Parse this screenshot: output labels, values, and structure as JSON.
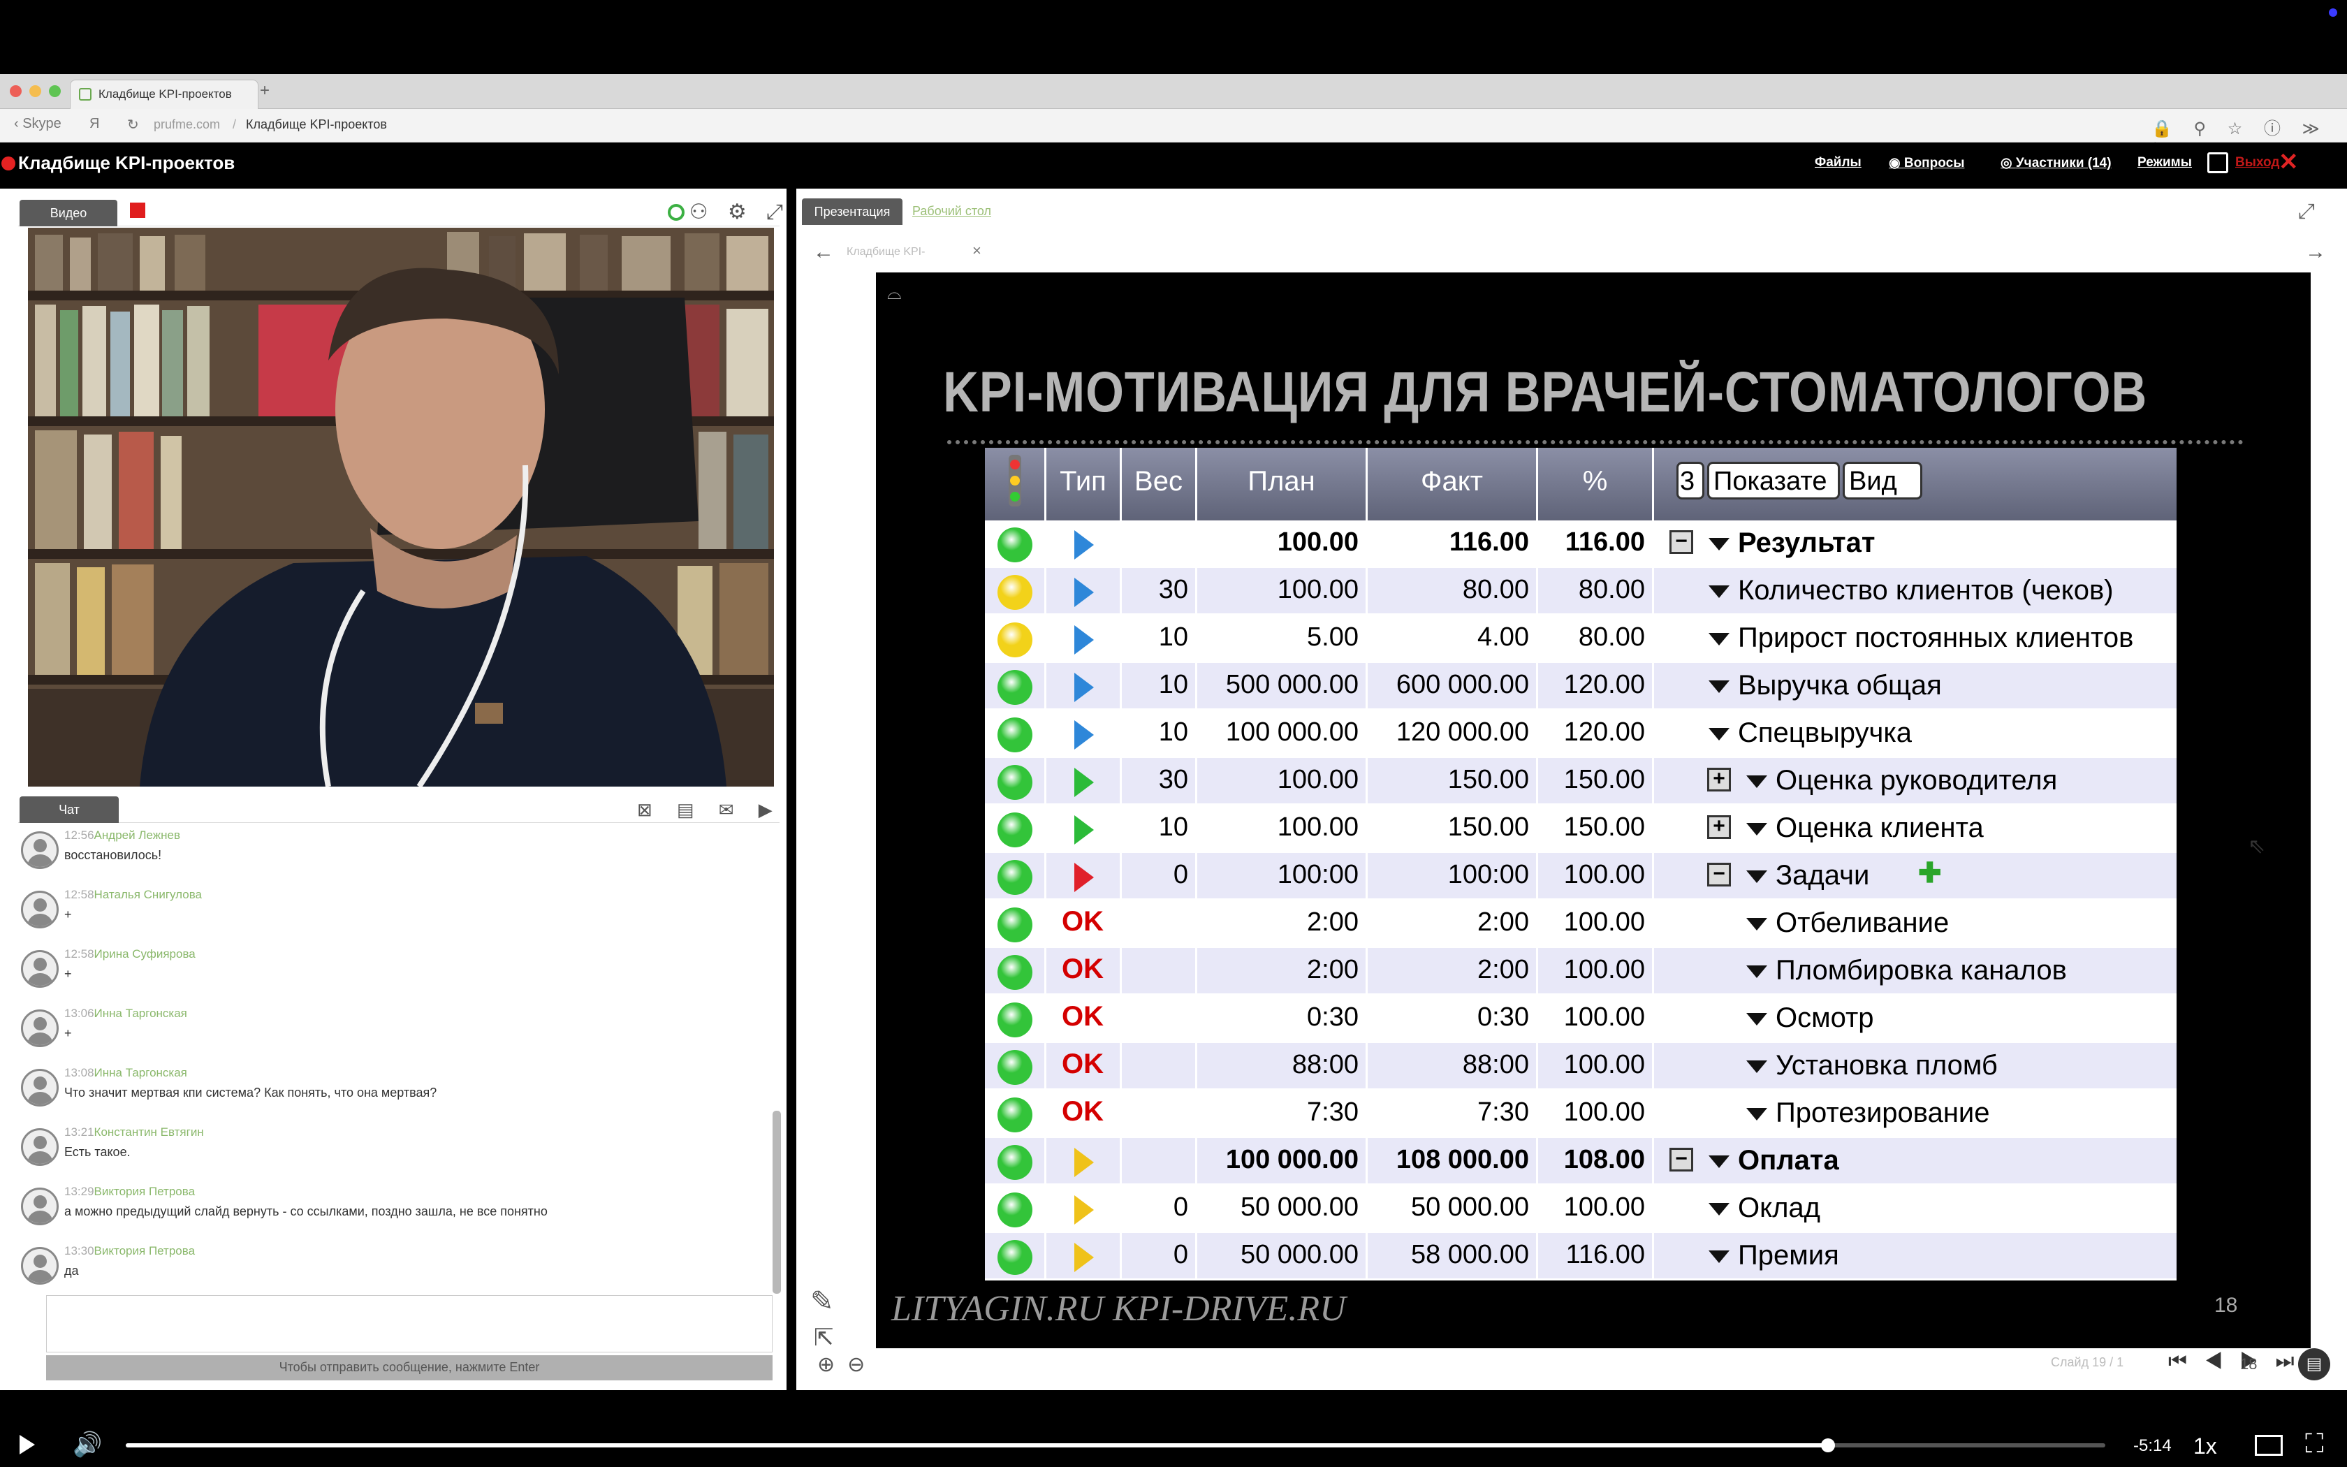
{
  "browser": {
    "tab_title": "Кладбище KPI-проектов",
    "back_label": "Skype",
    "yandex_glyph": "Я",
    "domain": "prufme.com",
    "separator": "/",
    "page_title": "Кладбище KPI-проектов",
    "new_tab_icon": "+",
    "toolbar_icons": "🔒 ⚲ ☆ ⓘ ≫ ⤓"
  },
  "app_header": {
    "title": "Кладбище KPI-проектов",
    "links": [
      "Файлы",
      "Вопросы",
      "Участники (14)",
      "Режимы"
    ],
    "exit_label": "Выход",
    "close_glyph": "✕"
  },
  "video_panel": {
    "tab_label": "Видео",
    "icons": "⚇ ⚙ ⤢"
  },
  "chat_panel": {
    "tab_label": "Чат",
    "icons": "⊠ ▤ ✉ ▶ ⤢",
    "send_hint": "Чтобы отправить сообщение, нажмите Enter",
    "messages": [
      {
        "time": "12:56",
        "author": "Андрей Лежнев",
        "text": "восстановилось!"
      },
      {
        "time": "12:58",
        "author": "Наталья Снигулова",
        "text": "+"
      },
      {
        "time": "12:58",
        "author": "Ирина Суфиярова",
        "text": "+"
      },
      {
        "time": "13:06",
        "author": "Инна Таргонская",
        "text": "+"
      },
      {
        "time": "13:08",
        "author": "Инна Таргонская",
        "text": "Что значит мертвая кпи система? Как понять, что она мертвая?"
      },
      {
        "time": "13:21",
        "author": "Константин Евтягин",
        "text": "Есть такое."
      },
      {
        "time": "13:29",
        "author": "Виктория Петрова",
        "text": "а можно предыдущий слайд вернуть - со ссылками, поздно зашла, не все понятно"
      },
      {
        "time": "13:30",
        "author": "Виктория Петрова",
        "text": "да"
      }
    ]
  },
  "presentation": {
    "tab_label": "Презентация",
    "desktop_link": "Рабочий стол",
    "doc_tab": "Кладбище KPI-",
    "doc_close": "×",
    "slide_title": "KPI-МОТИВАЦИЯ ДЛЯ ВРАЧЕЙ-СТОМАТОЛОГОВ",
    "slide_footer": "LITYAGIN.RU  KPI-DRIVE.RU",
    "slide_number": "18",
    "pager_text": "Слайд  19 / 1",
    "page_field": "18",
    "page_controls": "⏮ ◀    ▶ ⏭"
  },
  "kpi_table": {
    "headers": [
      "Тип",
      "Вес",
      "План",
      "Факт",
      "%"
    ],
    "header_select_count": "3",
    "header_select_show": "Показате",
    "header_select_view": "Вид",
    "status_colors": {
      "green": "#33c43a",
      "yellow": "#f2d21a",
      "red": "#e23a2a"
    },
    "type_colors": {
      "blue": "#2e87d9",
      "green": "#2bbb39",
      "red": "#e0202a",
      "yellow": "#efc21a"
    },
    "rows": [
      {
        "status": "green",
        "type": "blue",
        "weight": "",
        "plan": "100.00",
        "fact": "116.00",
        "pct": "116.00",
        "name": "Результат",
        "level": 0,
        "box": "−",
        "bold": true
      },
      {
        "status": "yellow",
        "type": "blue",
        "weight": "30",
        "plan": "100.00",
        "fact": "80.00",
        "pct": "80.00",
        "name": "Количество клиентов (чеков)",
        "level": 1,
        "box": ""
      },
      {
        "status": "yellow",
        "type": "blue",
        "weight": "10",
        "plan": "5.00",
        "fact": "4.00",
        "pct": "80.00",
        "name": "Прирост постоянных клиентов",
        "level": 1,
        "box": ""
      },
      {
        "status": "green",
        "type": "blue",
        "weight": "10",
        "plan": "500 000.00",
        "fact": "600 000.00",
        "pct": "120.00",
        "name": "Выручка общая",
        "level": 1,
        "box": ""
      },
      {
        "status": "green",
        "type": "blue",
        "weight": "10",
        "plan": "100 000.00",
        "fact": "120 000.00",
        "pct": "120.00",
        "name": "Спецвыручка",
        "level": 1,
        "box": ""
      },
      {
        "status": "green",
        "type": "green",
        "weight": "30",
        "plan": "100.00",
        "fact": "150.00",
        "pct": "150.00",
        "name": "Оценка руководителя",
        "level": 2,
        "box": "+"
      },
      {
        "status": "green",
        "type": "green",
        "weight": "10",
        "plan": "100.00",
        "fact": "150.00",
        "pct": "150.00",
        "name": "Оценка клиента",
        "level": 2,
        "box": "+"
      },
      {
        "status": "green",
        "type": "red",
        "weight": "0",
        "plan": "100:00",
        "fact": "100:00",
        "pct": "100.00",
        "name": "Задачи",
        "level": 2,
        "box": "−",
        "add": "✚"
      },
      {
        "status": "green",
        "type": "ok",
        "type_label": "OK",
        "weight": "",
        "plan": "2:00",
        "fact": "2:00",
        "pct": "100.00",
        "name": "Отбеливание",
        "level": 2,
        "box": ""
      },
      {
        "status": "green",
        "type": "ok",
        "type_label": "OK",
        "weight": "",
        "plan": "2:00",
        "fact": "2:00",
        "pct": "100.00",
        "name": "Пломбировка каналов",
        "level": 2,
        "box": ""
      },
      {
        "status": "green",
        "type": "ok",
        "type_label": "OK",
        "weight": "",
        "plan": "0:30",
        "fact": "0:30",
        "pct": "100.00",
        "name": "Осмотр",
        "level": 2,
        "box": ""
      },
      {
        "status": "green",
        "type": "ok",
        "type_label": "OK",
        "weight": "",
        "plan": "88:00",
        "fact": "88:00",
        "pct": "100.00",
        "name": "Установка пломб",
        "level": 2,
        "box": ""
      },
      {
        "status": "green",
        "type": "ok",
        "type_label": "OK",
        "weight": "",
        "plan": "7:30",
        "fact": "7:30",
        "pct": "100.00",
        "name": "Протезирование",
        "level": 2,
        "box": ""
      },
      {
        "status": "green",
        "type": "yellow",
        "weight": "",
        "plan": "100 000.00",
        "fact": "108 000.00",
        "pct": "108.00",
        "name": "Оплата",
        "level": 0,
        "box": "−",
        "bold": true
      },
      {
        "status": "green",
        "type": "yellow",
        "weight": "0",
        "plan": "50 000.00",
        "fact": "50 000.00",
        "pct": "100.00",
        "name": "Оклад",
        "level": 1,
        "box": ""
      },
      {
        "status": "green",
        "type": "yellow",
        "weight": "0",
        "plan": "50 000.00",
        "fact": "58 000.00",
        "pct": "116.00",
        "name": "Премия",
        "level": 1,
        "box": ""
      }
    ]
  },
  "player": {
    "time_remaining": "-5:14",
    "speed": "1x",
    "progress": 0.86
  }
}
